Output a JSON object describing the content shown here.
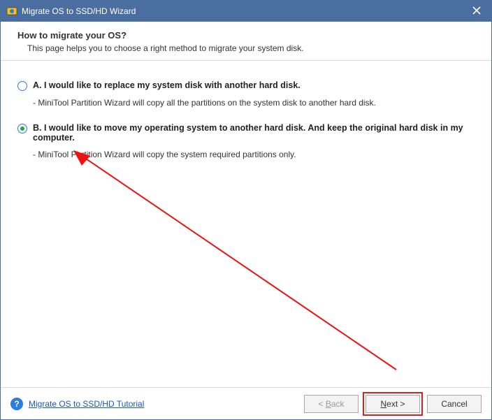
{
  "titlebar": {
    "title": "Migrate OS to SSD/HD Wizard"
  },
  "header": {
    "heading": "How to migrate your OS?",
    "sub": "This page helps you to choose a right method to migrate your system disk."
  },
  "options": {
    "a": {
      "label": "A. I would like to replace my system disk with another hard disk.",
      "desc": "- MiniTool Partition Wizard will copy all the partitions on the system disk to another hard disk."
    },
    "b": {
      "label": "B. I would like to move my operating system to another hard disk. And keep the original hard disk in my computer.",
      "desc": "- MiniTool Partition Wizard will copy the system required partitions only."
    }
  },
  "footer": {
    "help_symbol": "?",
    "tutorial": "Migrate OS to SSD/HD Tutorial",
    "back_prefix": "< ",
    "back_u": "B",
    "back_rest": "ack",
    "next_u": "N",
    "next_rest": "ext >",
    "cancel": "Cancel"
  }
}
